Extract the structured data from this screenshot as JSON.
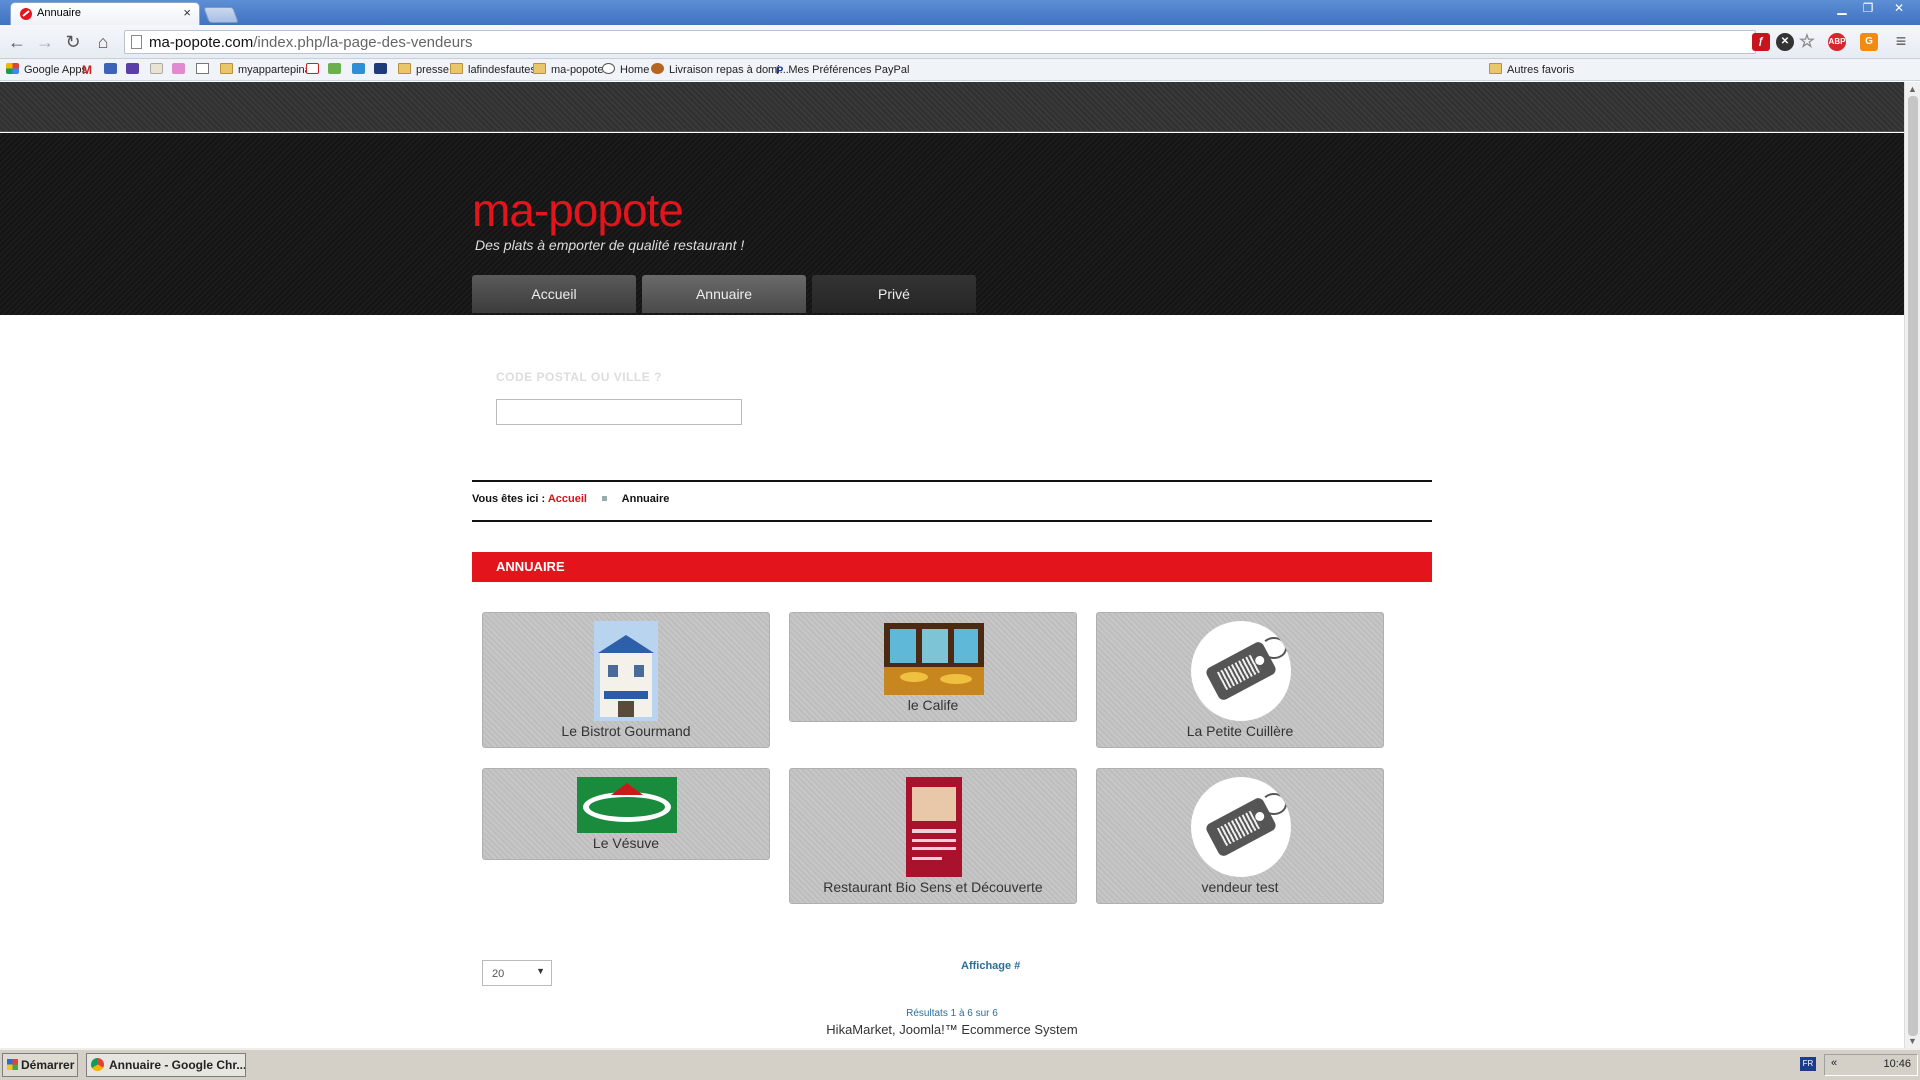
{
  "browser": {
    "tab_title": "Annuaire",
    "tab_close": "×",
    "url_host": "ma-popote.com",
    "url_path": "/index.php/la-page-des-vendeurs",
    "bookmarks": [
      {
        "label": "Google Apps"
      },
      {
        "label": "myappartepinal"
      },
      {
        "label": "presse"
      },
      {
        "label": "lafindesfautes"
      },
      {
        "label": "ma-popote"
      },
      {
        "label": "Home"
      },
      {
        "label": "Livraison repas à domi..."
      },
      {
        "label": "Mes Préférences PayPal"
      },
      {
        "label": "Autres favoris"
      }
    ]
  },
  "site": {
    "logo": "ma-popote",
    "tagline": "Des plats à emporter de qualité restaurant !",
    "menu": [
      {
        "label": "Accueil"
      },
      {
        "label": "Annuaire"
      },
      {
        "label": "Privé"
      }
    ],
    "search_label": "CODE POSTAL OU VILLE ?",
    "search_value": "",
    "breadcrumb_prefix": "Vous êtes ici :",
    "breadcrumb_link": "Accueil",
    "breadcrumb_current": "Annuaire",
    "section_title": "ANNUAIRE"
  },
  "vendors": [
    {
      "name": "Le Bistrot Gourmand",
      "thumb": "building-photo"
    },
    {
      "name": "le Calife",
      "thumb": "restaurant-interior-photo"
    },
    {
      "name": "La Petite Cuillère",
      "thumb": "tag-icon"
    },
    {
      "name": "Le Vésuve",
      "thumb": "vesuve-logo"
    },
    {
      "name": "Restaurant Bio Sens et Découverte",
      "thumb": "menu-flyer"
    },
    {
      "name": "vendeur test",
      "thumb": "tag-icon"
    }
  ],
  "pagination": {
    "per_page": "20",
    "display_label": "Affichage #",
    "results": "Résultats 1 à 6 sur 6",
    "powered_by": "HikaMarket, Joomla!™ Ecommerce System"
  },
  "taskbar": {
    "start": "Démarrer",
    "task": "Annuaire - Google Chr...",
    "lang": "FR",
    "tray_arrow": "«",
    "clock": "10:46"
  },
  "colors": {
    "brand_red": "#e3141b",
    "link_blue": "#2a6f9a"
  }
}
